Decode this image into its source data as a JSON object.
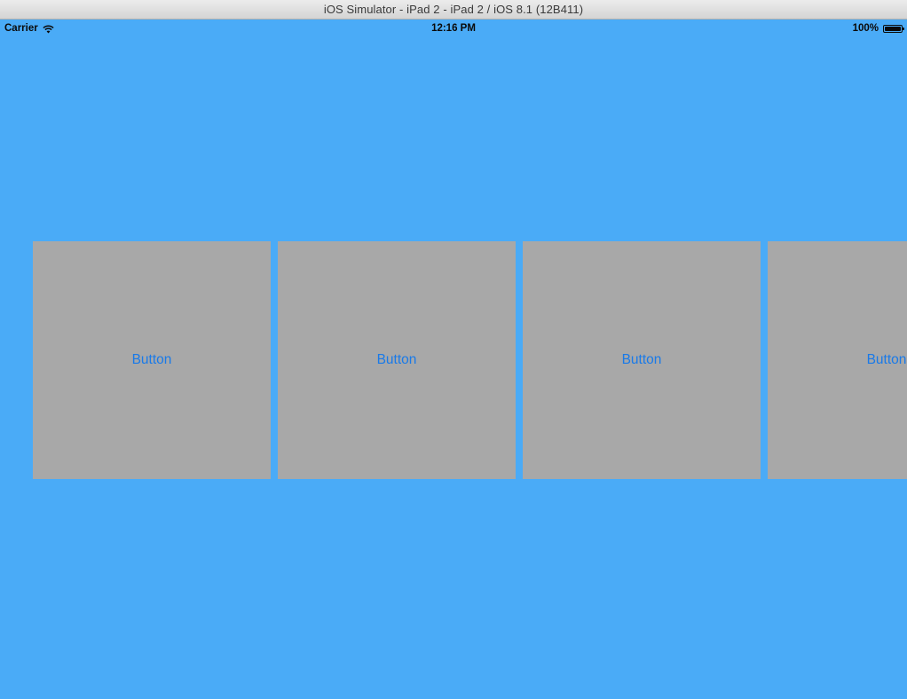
{
  "window": {
    "title": "iOS Simulator - iPad 2 - iPad 2 / iOS 8.1 (12B411)"
  },
  "status_bar": {
    "carrier": "Carrier",
    "time": "12:16 PM",
    "battery": "100%",
    "icons": [
      "wifi-icon",
      "battery-icon"
    ]
  },
  "colors": {
    "background": "#4aabf7",
    "tile": "#a8a8a8",
    "button_text": "#1a7ae8"
  },
  "buttons": [
    {
      "label": "Button"
    },
    {
      "label": "Button"
    },
    {
      "label": "Button"
    },
    {
      "label": "Button"
    }
  ]
}
